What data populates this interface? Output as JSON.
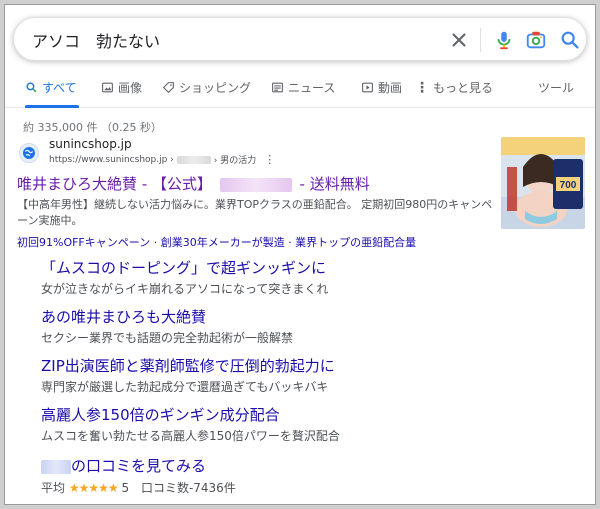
{
  "search": {
    "query": "アソコ　勃たない"
  },
  "tabs": [
    {
      "label": "すべて"
    },
    {
      "label": "画像"
    },
    {
      "label": "ショッピング"
    },
    {
      "label": "ニュース"
    },
    {
      "label": "動画"
    },
    {
      "label": "もっと見る"
    },
    {
      "label": "ツール"
    }
  ],
  "result_stats": "約 335,000 件 （0.25 秒）",
  "result": {
    "domain": "sunincshop.jp",
    "url_prefix": "https://www.sunincshop.jp ›",
    "url_suffix": "› 男の活力",
    "title_a": "唯井まひろ大絶賛 - 【公式】",
    "title_b": "- 送料無料",
    "snippet": "【中高年男性】継続しない活力悩みに。業界TOPクラスの亜鉛配合。 定期初回980円のキャンペーン実施中。",
    "sub_info": "初回91%OFFキャンペーン · 創業30年メーカーが製造 · 業界トップの亜鉛配合量",
    "thumbnail_text": "700"
  },
  "sitelinks": [
    {
      "title": "「ムスコのドーピング」で超ギンッギンに",
      "desc": "女が泣きながらイキ崩れるアソコになって突きまくれ"
    },
    {
      "title": "あの唯井まひろも大絶賛",
      "desc": "セクシー業界でも話題の完全勃起術が一般解禁"
    },
    {
      "title": "ZIP出演医師と薬剤師監修で圧倒的勃起力に",
      "desc": "専門家が厳選した勃起成分で還暦過ぎてもバッキバキ"
    },
    {
      "title": "高麗人参150倍のギンギン成分配合",
      "desc": "ムスコを奮い勃たせる高麗人参150倍パワーを贅沢配合"
    }
  ],
  "reviews_link": "の口コミを見てみる",
  "rating": {
    "label": "平均",
    "stars": "★★★★★",
    "score": "5",
    "count_text": "口コミ数-7436件"
  },
  "colors": {
    "link": "#1a0dab",
    "visited": "#681da8",
    "accent": "#1a73e8",
    "star": "#f5a623"
  }
}
